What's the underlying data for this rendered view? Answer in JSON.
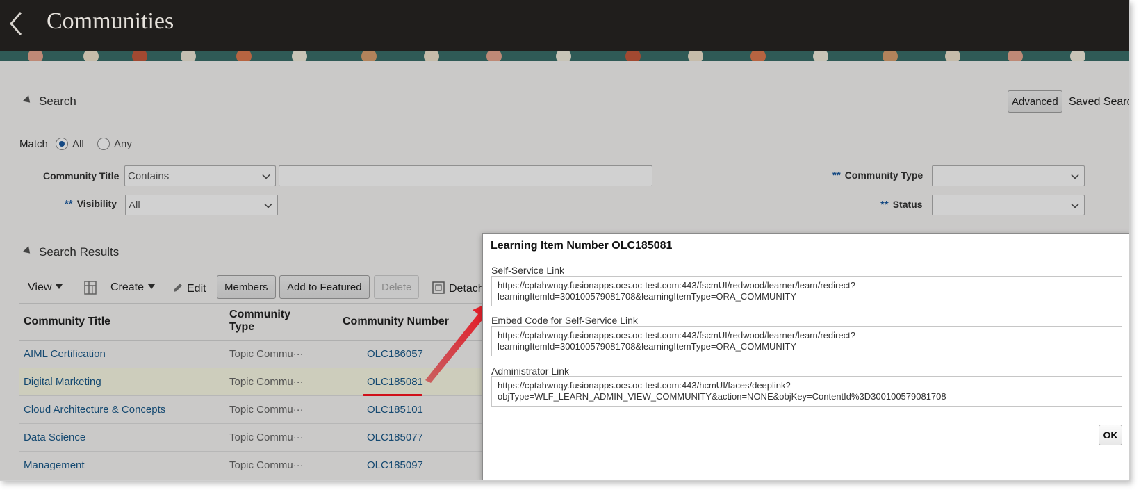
{
  "header": {
    "title": "Communities",
    "back_icon": "chevron-left-icon"
  },
  "search": {
    "section_label": "Search",
    "advanced_label": "Advanced",
    "saved_search_label": "Saved Search",
    "match_label": "Match",
    "match_all": "All",
    "match_any": "Any",
    "match_selected": "All",
    "community_title_label": "Community Title",
    "community_title_operator": "Contains",
    "community_title_value": "",
    "visibility_label": "Visibility",
    "visibility_value": "All",
    "community_type_label": "Community Type",
    "community_type_value": "",
    "status_label": "Status",
    "status_value": "",
    "required_marker": "**"
  },
  "results": {
    "section_label": "Search Results",
    "toolbar": {
      "view": "View",
      "create": "Create",
      "edit": "Edit",
      "members": "Members",
      "add_to_featured": "Add to Featured",
      "delete": "Delete",
      "detach": "Detach"
    },
    "columns": [
      "Community Title",
      "Community Type",
      "Community Number"
    ],
    "column_type_line1": "Community",
    "column_type_line2": "Type",
    "rows": [
      {
        "title": "AIML Certification",
        "type": "Topic Commu···",
        "number": "OLC186057"
      },
      {
        "title": "Digital Marketing",
        "type": "Topic Commu···",
        "number": "OLC185081"
      },
      {
        "title": "Cloud Architecture & Concepts",
        "type": "Topic Commu···",
        "number": "OLC185101"
      },
      {
        "title": "Data Science",
        "type": "Topic Commu···",
        "number": "OLC185077"
      },
      {
        "title": "Management",
        "type": "Topic Commu···",
        "number": "OLC185097"
      }
    ],
    "selected_row": 1
  },
  "dialog": {
    "title": "Learning Item Number OLC185081",
    "self_service_label": "Self-Service Link",
    "self_service_value": "https://cptahwnqy.fusionapps.ocs.oc-test.com:443/fscmUI/redwood/learner/learn/redirect?\nlearningItemId=300100579081708&learningItemType=ORA_COMMUNITY",
    "embed_label": "Embed Code for Self-Service Link",
    "embed_value": "https://cptahwnqy.fusionapps.ocs.oc-test.com:443/fscmUI/redwood/learner/learn/redirect?\nlearningItemId=300100579081708&learningItemType=ORA_COMMUNITY",
    "admin_label": "Administrator Link",
    "admin_value": "https://cptahwnqy.fusionapps.ocs.oc-test.com:443/hcmUI/faces/deeplink?\nobjType=WLF_LEARN_ADMIN_VIEW_COMMUNITY&action=NONE&objKey=ContentId%3D300100579081708",
    "ok_label": "OK"
  },
  "colors": {
    "header_bg": "#201e1c",
    "link": "#1a5a8a",
    "required": "#1a5aa0",
    "annotation": "#d0101a"
  }
}
